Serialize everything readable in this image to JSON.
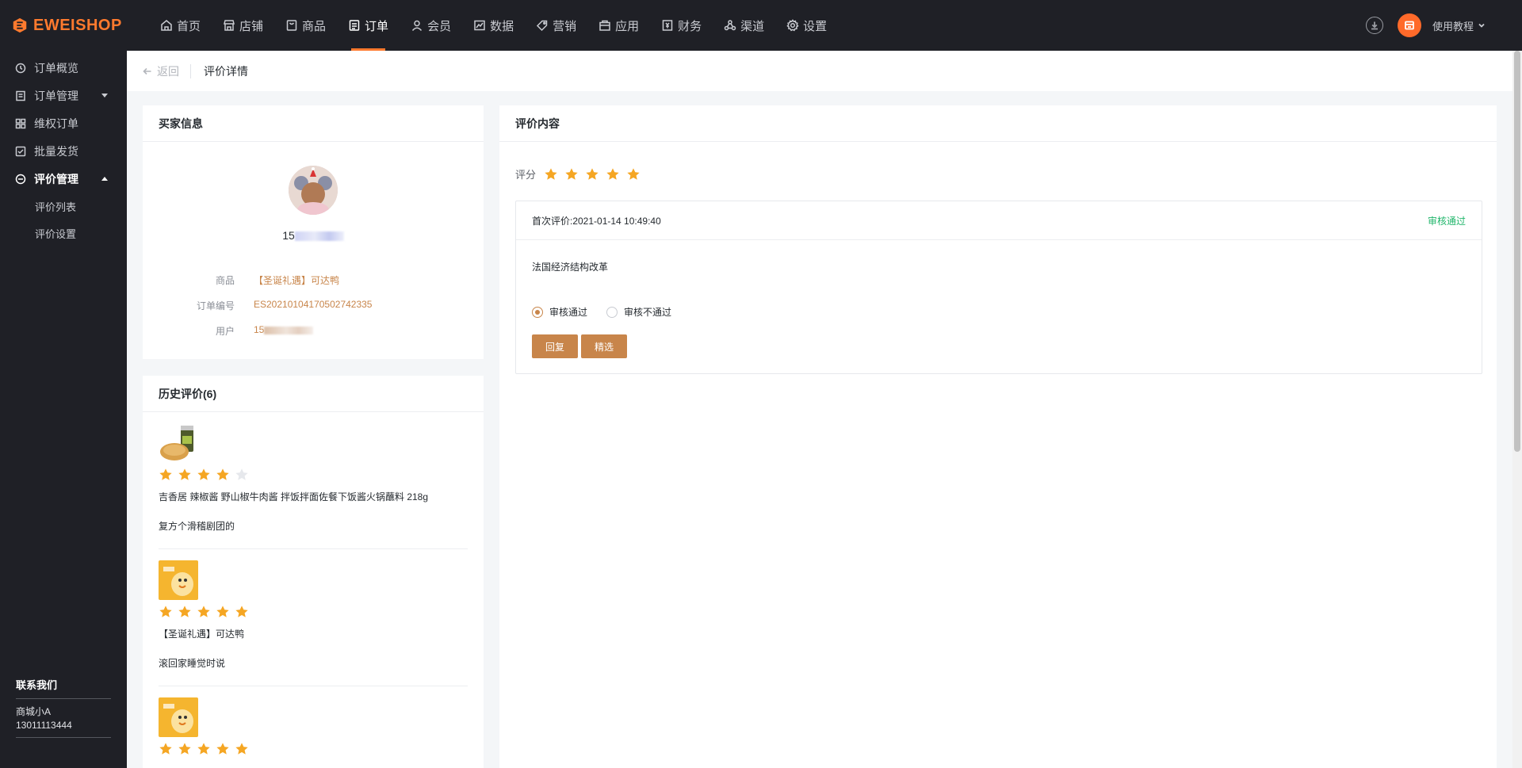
{
  "brand": {
    "name": "EWEISHOP",
    "color": "#ff7a2e"
  },
  "topnav": {
    "items": [
      {
        "label": "首页",
        "icon": "home-icon"
      },
      {
        "label": "店铺",
        "icon": "store-icon"
      },
      {
        "label": "商品",
        "icon": "goods-icon"
      },
      {
        "label": "订单",
        "icon": "order-icon",
        "active": true
      },
      {
        "label": "会员",
        "icon": "member-icon"
      },
      {
        "label": "数据",
        "icon": "data-icon"
      },
      {
        "label": "营销",
        "icon": "tag-icon"
      },
      {
        "label": "应用",
        "icon": "app-icon"
      },
      {
        "label": "财务",
        "icon": "finance-icon"
      },
      {
        "label": "渠道",
        "icon": "channel-icon"
      },
      {
        "label": "设置",
        "icon": "gear-icon"
      }
    ],
    "tutorial": "使用教程"
  },
  "sidebar": {
    "items": [
      {
        "label": "订单概览",
        "icon": "clock-icon"
      },
      {
        "label": "订单管理",
        "icon": "list-icon"
      },
      {
        "label": "维权订单",
        "icon": "grid-icon"
      },
      {
        "label": "批量发货",
        "icon": "ship-icon"
      },
      {
        "label": "评价管理",
        "icon": "comment-icon",
        "active": true
      }
    ],
    "subitems": [
      {
        "label": "评价列表"
      },
      {
        "label": "评价设置"
      }
    ],
    "contact": {
      "title": "联系我们",
      "name": "商城小A",
      "phone": "13011113444"
    }
  },
  "breadcrumb": {
    "back": "返回",
    "title": "评价详情"
  },
  "buyer": {
    "title": "买家信息",
    "name": "15",
    "goods_label": "商品",
    "goods_value": "【圣诞礼遇】可达鸭",
    "order_label": "订单编号",
    "order_value": "ES20210104170502742335",
    "user_label": "用户",
    "user_value": "15"
  },
  "history": {
    "title": "历史评价(6)",
    "items": [
      {
        "rating": 4,
        "title": "吉香居 辣椒酱 野山椒牛肉酱 拌饭拌面佐餐下饭酱火锅蘸料 218g",
        "text": "复方个滑稽剧团的"
      },
      {
        "rating": 5,
        "title": "【圣诞礼遇】可达鸭",
        "text": "滚回家睡觉时说"
      },
      {
        "rating": 5,
        "title": "",
        "text": ""
      }
    ]
  },
  "review": {
    "title": "评价内容",
    "score_label": "评分",
    "rating": 5,
    "first_review": "首次评价:2021-01-14 10:49:40",
    "status": "审核通过",
    "content": "法国经济结构改革",
    "radio_pass": "审核通过",
    "radio_fail": "审核不通过",
    "reply_btn": "回复",
    "select_btn": "精选"
  },
  "colors": {
    "accent": "#c8854a",
    "star": "#f5a623",
    "star_empty": "#e6e8ec",
    "success": "#21b66b"
  }
}
